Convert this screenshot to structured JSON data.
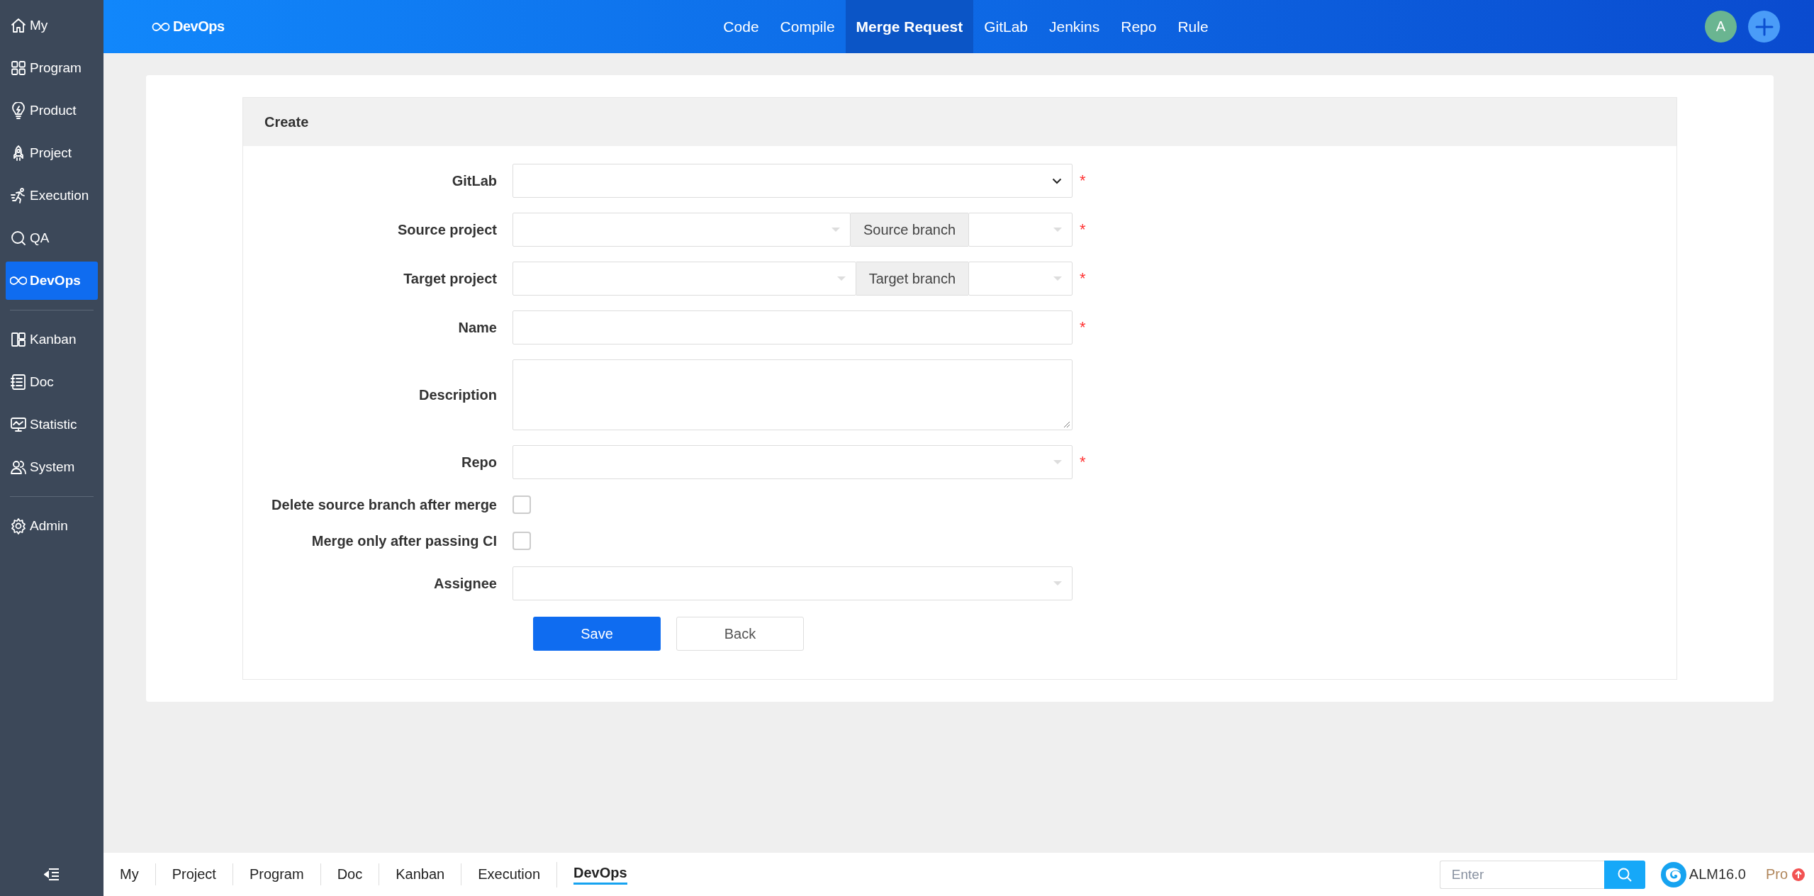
{
  "sidebar": {
    "groups": [
      [
        {
          "label": "My",
          "selected": false
        },
        {
          "label": "Program",
          "selected": false
        },
        {
          "label": "Product",
          "selected": false
        },
        {
          "label": "Project",
          "selected": false
        },
        {
          "label": "Execution",
          "selected": false
        },
        {
          "label": "QA",
          "selected": false
        },
        {
          "label": "DevOps",
          "selected": true
        }
      ],
      [
        {
          "label": "Kanban",
          "selected": false
        },
        {
          "label": "Doc",
          "selected": false
        },
        {
          "label": "Statistic",
          "selected": false
        },
        {
          "label": "System",
          "selected": false
        }
      ],
      [
        {
          "label": "Admin",
          "selected": false
        }
      ]
    ]
  },
  "header": {
    "logo": "DevOps",
    "nav": [
      {
        "label": "Code",
        "selected": false
      },
      {
        "label": "Compile",
        "selected": false
      },
      {
        "label": "Merge Request",
        "selected": true
      },
      {
        "label": "GitLab",
        "selected": false
      },
      {
        "label": "Jenkins",
        "selected": false
      },
      {
        "label": "Repo",
        "selected": false
      },
      {
        "label": "Rule",
        "selected": false
      }
    ],
    "avatar": "A"
  },
  "form": {
    "title": "Create",
    "fields": [
      {
        "label": "GitLab",
        "kind": "native-select",
        "required_mark": "*"
      },
      {
        "label": "Source project",
        "kind": "pair",
        "addon": "Source branch",
        "required_mark": "*"
      },
      {
        "label": "Target project",
        "kind": "pair",
        "addon": "Target branch",
        "required_mark": "*"
      },
      {
        "label": "Name",
        "kind": "text",
        "required_mark": "*"
      },
      {
        "label": "Description",
        "kind": "textarea"
      },
      {
        "label": "Repo",
        "kind": "select",
        "required_mark": "*"
      },
      {
        "label": "Delete source branch after merge",
        "kind": "checkbox",
        "checked": false
      },
      {
        "label": "Merge only after passing CI",
        "kind": "checkbox",
        "checked": false
      },
      {
        "label": "Assignee",
        "kind": "select"
      }
    ],
    "buttons": [
      {
        "label": "Save",
        "kind": "primary"
      },
      {
        "label": "Back",
        "kind": "secondary"
      }
    ]
  },
  "footer": {
    "tabs": [
      {
        "label": "My",
        "selected": false
      },
      {
        "label": "Project",
        "selected": false
      },
      {
        "label": "Program",
        "selected": false
      },
      {
        "label": "Doc",
        "selected": false
      },
      {
        "label": "Kanban",
        "selected": false
      },
      {
        "label": "Execution",
        "selected": false
      },
      {
        "label": "DevOps",
        "selected": true
      }
    ],
    "search": {
      "placeholder": "Enter"
    },
    "version": "ALM16.0",
    "edition": "Pro"
  }
}
